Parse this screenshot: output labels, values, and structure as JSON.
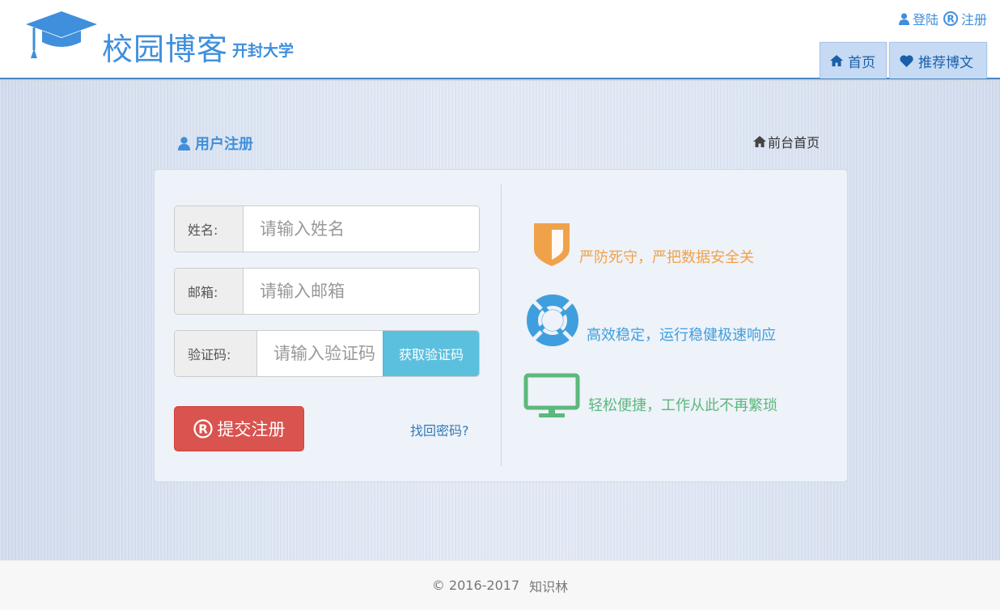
{
  "header": {
    "site_title": "校园博客",
    "site_subtitle": "开封大学",
    "login_label": "登陆",
    "register_label": "注册",
    "nav": {
      "home": "首页",
      "recommended": "推荐博文"
    }
  },
  "page": {
    "section_title": "用户注册",
    "home_link": "前台首页"
  },
  "form": {
    "name": {
      "label": "姓名:",
      "placeholder": "请输入姓名"
    },
    "email": {
      "label": "邮箱:",
      "placeholder": "请输入邮箱"
    },
    "code": {
      "label": "验证码:",
      "placeholder": "请输入验证码",
      "button": "获取验证码"
    },
    "submit": "提交注册",
    "forgot": "找回密码?"
  },
  "features": [
    {
      "text": "严防死守，严把数据安全关",
      "icon": "shield-icon",
      "color": "#f0a24a"
    },
    {
      "text": "高效稳定，运行稳健极速响应",
      "icon": "life-ring-icon",
      "color": "#3f9fde"
    },
    {
      "text": "轻松便捷，工作从此不再繁琐",
      "icon": "monitor-icon",
      "color": "#5cb87c"
    }
  ],
  "footer": {
    "copyright": "© 2016-2017",
    "author": "知识林"
  },
  "colors": {
    "brand": "#3f8fdc",
    "danger": "#d9534f",
    "info": "#5bc0de"
  }
}
